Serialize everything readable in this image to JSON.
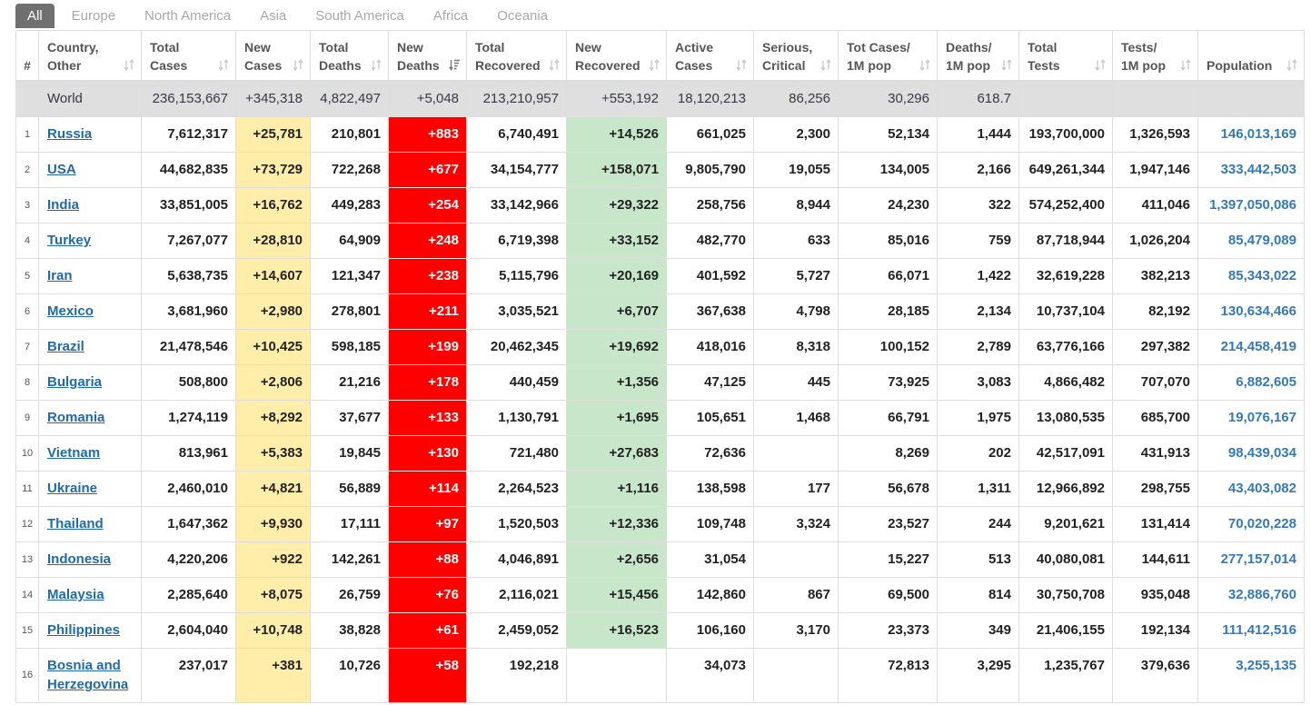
{
  "tabs": [
    {
      "label": "All",
      "active": true
    },
    {
      "label": "Europe",
      "active": false
    },
    {
      "label": "North America",
      "active": false
    },
    {
      "label": "Asia",
      "active": false
    },
    {
      "label": "South America",
      "active": false
    },
    {
      "label": "Africa",
      "active": false
    },
    {
      "label": "Oceania",
      "active": false
    }
  ],
  "table": {
    "columns": [
      "#",
      "Country,\nOther",
      "Total\nCases",
      "New\nCases",
      "Total\nDeaths",
      "New\nDeaths",
      "Total\nRecovered",
      "New\nRecovered",
      "Active\nCases",
      "Serious,\nCritical",
      "Tot Cases/\n1M pop",
      "Deaths/\n1M pop",
      "Total\nTests",
      "Tests/\n1M pop",
      "Population"
    ],
    "sort": {
      "column": 5,
      "icon": "sort-descending-icon"
    },
    "world": {
      "country": "World",
      "total_cases": "236,153,667",
      "new_cases": "+345,318",
      "total_deaths": "4,822,497",
      "new_deaths": "+5,048",
      "total_recovered": "213,210,957",
      "new_recovered": "+553,192",
      "active_cases": "18,120,213",
      "serious_critical": "86,256",
      "tot_cases_1m_pop": "30,296",
      "deaths_1m_pop": "618.7"
    },
    "rows": [
      {
        "rank": "1",
        "country": "Russia",
        "total_cases": "7,612,317",
        "new_cases": "+25,781",
        "total_deaths": "210,801",
        "new_deaths": "+883",
        "total_recovered": "6,740,491",
        "new_recovered": "+14,526",
        "active_cases": "661,025",
        "serious_critical": "2,300",
        "tot_cases_1m_pop": "52,134",
        "deaths_1m_pop": "1,444",
        "total_tests": "193,700,000",
        "tests_1m_pop": "1,326,593",
        "population": "146,013,169"
      },
      {
        "rank": "2",
        "country": "USA",
        "total_cases": "44,682,835",
        "new_cases": "+73,729",
        "total_deaths": "722,268",
        "new_deaths": "+677",
        "total_recovered": "34,154,777",
        "new_recovered": "+158,071",
        "active_cases": "9,805,790",
        "serious_critical": "19,055",
        "tot_cases_1m_pop": "134,005",
        "deaths_1m_pop": "2,166",
        "total_tests": "649,261,344",
        "tests_1m_pop": "1,947,146",
        "population": "333,442,503"
      },
      {
        "rank": "3",
        "country": "India",
        "total_cases": "33,851,005",
        "new_cases": "+16,762",
        "total_deaths": "449,283",
        "new_deaths": "+254",
        "total_recovered": "33,142,966",
        "new_recovered": "+29,322",
        "active_cases": "258,756",
        "serious_critical": "8,944",
        "tot_cases_1m_pop": "24,230",
        "deaths_1m_pop": "322",
        "total_tests": "574,252,400",
        "tests_1m_pop": "411,046",
        "population": "1,397,050,086"
      },
      {
        "rank": "4",
        "country": "Turkey",
        "total_cases": "7,267,077",
        "new_cases": "+28,810",
        "total_deaths": "64,909",
        "new_deaths": "+248",
        "total_recovered": "6,719,398",
        "new_recovered": "+33,152",
        "active_cases": "482,770",
        "serious_critical": "633",
        "tot_cases_1m_pop": "85,016",
        "deaths_1m_pop": "759",
        "total_tests": "87,718,944",
        "tests_1m_pop": "1,026,204",
        "population": "85,479,089"
      },
      {
        "rank": "5",
        "country": "Iran",
        "total_cases": "5,638,735",
        "new_cases": "+14,607",
        "total_deaths": "121,347",
        "new_deaths": "+238",
        "total_recovered": "5,115,796",
        "new_recovered": "+20,169",
        "active_cases": "401,592",
        "serious_critical": "5,727",
        "tot_cases_1m_pop": "66,071",
        "deaths_1m_pop": "1,422",
        "total_tests": "32,619,228",
        "tests_1m_pop": "382,213",
        "population": "85,343,022"
      },
      {
        "rank": "6",
        "country": "Mexico",
        "total_cases": "3,681,960",
        "new_cases": "+2,980",
        "total_deaths": "278,801",
        "new_deaths": "+211",
        "total_recovered": "3,035,521",
        "new_recovered": "+6,707",
        "active_cases": "367,638",
        "serious_critical": "4,798",
        "tot_cases_1m_pop": "28,185",
        "deaths_1m_pop": "2,134",
        "total_tests": "10,737,104",
        "tests_1m_pop": "82,192",
        "population": "130,634,466"
      },
      {
        "rank": "7",
        "country": "Brazil",
        "total_cases": "21,478,546",
        "new_cases": "+10,425",
        "total_deaths": "598,185",
        "new_deaths": "+199",
        "total_recovered": "20,462,345",
        "new_recovered": "+19,692",
        "active_cases": "418,016",
        "serious_critical": "8,318",
        "tot_cases_1m_pop": "100,152",
        "deaths_1m_pop": "2,789",
        "total_tests": "63,776,166",
        "tests_1m_pop": "297,382",
        "population": "214,458,419"
      },
      {
        "rank": "8",
        "country": "Bulgaria",
        "total_cases": "508,800",
        "new_cases": "+2,806",
        "total_deaths": "21,216",
        "new_deaths": "+178",
        "total_recovered": "440,459",
        "new_recovered": "+1,356",
        "active_cases": "47,125",
        "serious_critical": "445",
        "tot_cases_1m_pop": "73,925",
        "deaths_1m_pop": "3,083",
        "total_tests": "4,866,482",
        "tests_1m_pop": "707,070",
        "population": "6,882,605"
      },
      {
        "rank": "9",
        "country": "Romania",
        "total_cases": "1,274,119",
        "new_cases": "+8,292",
        "total_deaths": "37,677",
        "new_deaths": "+133",
        "total_recovered": "1,130,791",
        "new_recovered": "+1,695",
        "active_cases": "105,651",
        "serious_critical": "1,468",
        "tot_cases_1m_pop": "66,791",
        "deaths_1m_pop": "1,975",
        "total_tests": "13,080,535",
        "tests_1m_pop": "685,700",
        "population": "19,076,167"
      },
      {
        "rank": "10",
        "country": "Vietnam",
        "total_cases": "813,961",
        "new_cases": "+5,383",
        "total_deaths": "19,845",
        "new_deaths": "+130",
        "total_recovered": "721,480",
        "new_recovered": "+27,683",
        "active_cases": "72,636",
        "tot_cases_1m_pop": "8,269",
        "deaths_1m_pop": "202",
        "total_tests": "42,517,091",
        "tests_1m_pop": "431,913",
        "population": "98,439,034"
      },
      {
        "rank": "11",
        "country": "Ukraine",
        "total_cases": "2,460,010",
        "new_cases": "+4,821",
        "total_deaths": "56,889",
        "new_deaths": "+114",
        "total_recovered": "2,264,523",
        "new_recovered": "+1,116",
        "active_cases": "138,598",
        "serious_critical": "177",
        "tot_cases_1m_pop": "56,678",
        "deaths_1m_pop": "1,311",
        "total_tests": "12,966,892",
        "tests_1m_pop": "298,755",
        "population": "43,403,082"
      },
      {
        "rank": "12",
        "country": "Thailand",
        "total_cases": "1,647,362",
        "new_cases": "+9,930",
        "total_deaths": "17,111",
        "new_deaths": "+97",
        "total_recovered": "1,520,503",
        "new_recovered": "+12,336",
        "active_cases": "109,748",
        "serious_critical": "3,324",
        "tot_cases_1m_pop": "23,527",
        "deaths_1m_pop": "244",
        "total_tests": "9,201,621",
        "tests_1m_pop": "131,414",
        "population": "70,020,228"
      },
      {
        "rank": "13",
        "country": "Indonesia",
        "total_cases": "4,220,206",
        "new_cases": "+922",
        "total_deaths": "142,261",
        "new_deaths": "+88",
        "total_recovered": "4,046,891",
        "new_recovered": "+2,656",
        "active_cases": "31,054",
        "tot_cases_1m_pop": "15,227",
        "deaths_1m_pop": "513",
        "total_tests": "40,080,081",
        "tests_1m_pop": "144,611",
        "population": "277,157,014"
      },
      {
        "rank": "14",
        "country": "Malaysia",
        "total_cases": "2,285,640",
        "new_cases": "+8,075",
        "total_deaths": "26,759",
        "new_deaths": "+76",
        "total_recovered": "2,116,021",
        "new_recovered": "+15,456",
        "active_cases": "142,860",
        "serious_critical": "867",
        "tot_cases_1m_pop": "69,500",
        "deaths_1m_pop": "814",
        "total_tests": "30,750,708",
        "tests_1m_pop": "935,048",
        "population": "32,886,760"
      },
      {
        "rank": "15",
        "country": "Philippines",
        "total_cases": "2,604,040",
        "new_cases": "+10,748",
        "total_deaths": "38,828",
        "new_deaths": "+61",
        "total_recovered": "2,459,052",
        "new_recovered": "+16,523",
        "active_cases": "106,160",
        "serious_critical": "3,170",
        "tot_cases_1m_pop": "23,373",
        "deaths_1m_pop": "349",
        "total_tests": "21,406,155",
        "tests_1m_pop": "192,134",
        "population": "111,412,516"
      },
      {
        "rank": "16",
        "country": "Bosnia and Herzegovina",
        "total_cases": "237,017",
        "new_cases": "+381",
        "total_deaths": "10,726",
        "new_deaths": "+58",
        "total_recovered": "192,218",
        "active_cases": "34,073",
        "tot_cases_1m_pop": "72,813",
        "deaths_1m_pop": "3,295",
        "total_tests": "1,235,767",
        "tests_1m_pop": "379,636",
        "population": "3,255,135"
      }
    ]
  },
  "icons": {
    "sortable": "sort-icon"
  },
  "colors": {
    "tab_active_bg": "#707070",
    "new_cases_bg": "#ffeeaa",
    "new_deaths_bg": "#ff0000",
    "new_recovered_bg": "#c8e6c9",
    "world_row_bg": "#dfdfdf",
    "link": "#1f6aa8",
    "population": "#3479b8"
  }
}
